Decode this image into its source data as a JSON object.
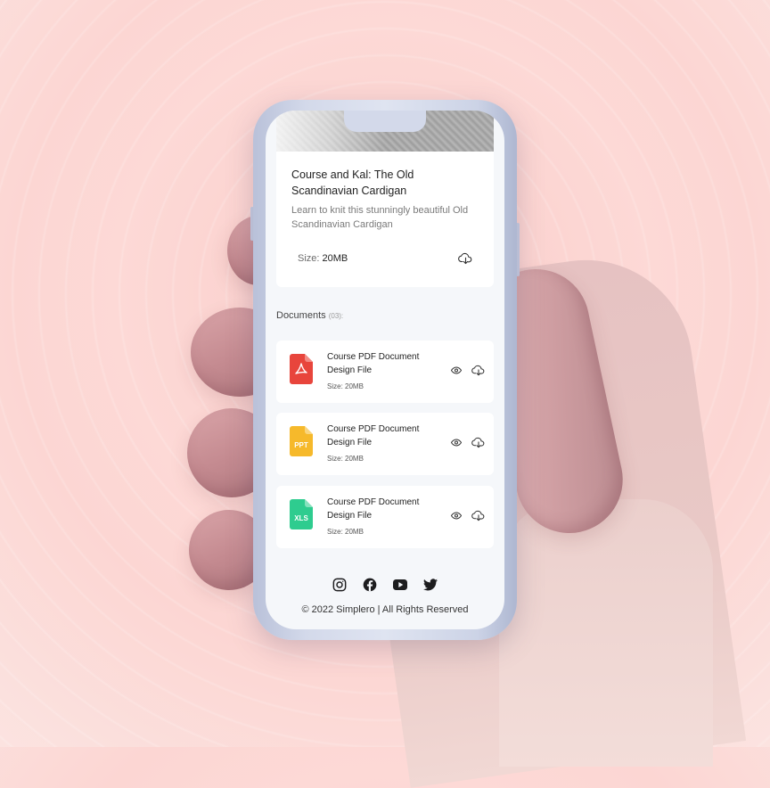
{
  "course": {
    "title": "Course and Kal: The Old Scandinavian Cardigan",
    "description": "Learn to knit this stunningly beautiful Old Scandinavian Cardigan",
    "size_label": "Size:",
    "size_value": "20MB",
    "download_icon": "cloud-download-icon"
  },
  "documents": {
    "heading": "Documents",
    "count": "(03):",
    "items": [
      {
        "title": "Course PDF Document Design File",
        "size": "Size: 20MB",
        "type_label": "",
        "icon": "pdf-file-icon",
        "color": "#e8453c"
      },
      {
        "title": "Course PDF Document Design File",
        "size": "Size: 20MB",
        "type_label": "PPT",
        "icon": "ppt-file-icon",
        "color": "#f6b92b"
      },
      {
        "title": "Course PDF Document Design File",
        "size": "Size: 20MB",
        "type_label": "XLS",
        "icon": "xls-file-icon",
        "color": "#2ecc8f"
      }
    ]
  },
  "social": [
    "instagram-icon",
    "facebook-icon",
    "youtube-icon",
    "twitter-icon"
  ],
  "footer": {
    "copyright": "© 2022 Simplero | All Rights Reserved"
  }
}
